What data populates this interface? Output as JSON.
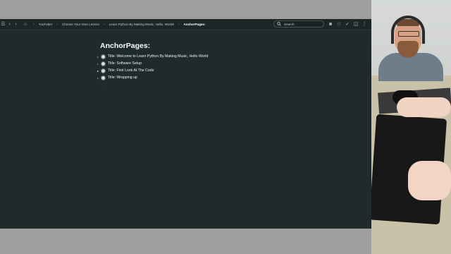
{
  "topbar": {
    "nav_icons": [
      "sidebar-toggle-icon",
      "back-icon",
      "forward-icon"
    ],
    "breadcrumb": {
      "home_icon": "home-icon",
      "items": [
        "YouTuber",
        "Choose Your Own Lesson",
        "Learn Python By Making Music; Hello, World!",
        "AnchorPages:"
      ]
    },
    "search": {
      "placeholder": "Search"
    },
    "right_icons": [
      "add-user-icon",
      "star-icon",
      "check-icon",
      "columns-icon",
      "more-icon"
    ]
  },
  "page": {
    "title": "AnchorPages:",
    "blocks": [
      {
        "label": "Title: Welcome to Learn Python By Making Music, Hello World"
      },
      {
        "label": "Title: Software Setup"
      },
      {
        "label": "Title: First Look At The Code"
      },
      {
        "label": "Title: Wrapping up"
      }
    ]
  },
  "colors": {
    "editor_bg": "#1f2a2a",
    "topbar_bg": "#1c2626",
    "text": "#eef2f2"
  }
}
